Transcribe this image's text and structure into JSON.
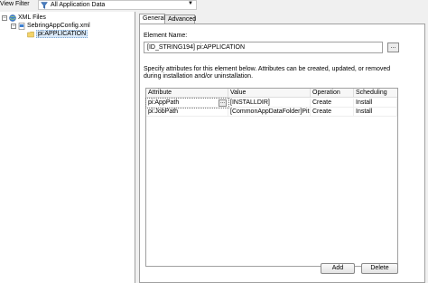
{
  "toolbar": {
    "view_filter_label": "View Filter",
    "filter_value": "All Application Data"
  },
  "tree": {
    "root": "XML Files",
    "file": "SebringAppConfig.xml",
    "element": "pi:APPLICATION"
  },
  "tabs": {
    "general": "General",
    "advanced": "Advanced"
  },
  "element": {
    "label": "Element Name:",
    "value": "[ID_STRING194] pi:APPLICATION",
    "browse": "..."
  },
  "description": "Specify attributes for this element below. Attributes can be created, updated, or removed during installation and/or uninstallation.",
  "grid": {
    "columns": [
      "Attribute",
      "Value",
      "Operation",
      "Scheduling"
    ],
    "rows": [
      {
        "attribute": "pi:AppPath",
        "value": "[INSTALLDIR]",
        "operation": "Create",
        "scheduling": "Install"
      },
      {
        "attribute": "pi:JobPath",
        "value": "[CommonAppDataFolder]Pitn...",
        "operation": "Create",
        "scheduling": "Install"
      }
    ],
    "cell_button": "..."
  },
  "buttons": {
    "add": "Add",
    "delete": "Delete"
  }
}
